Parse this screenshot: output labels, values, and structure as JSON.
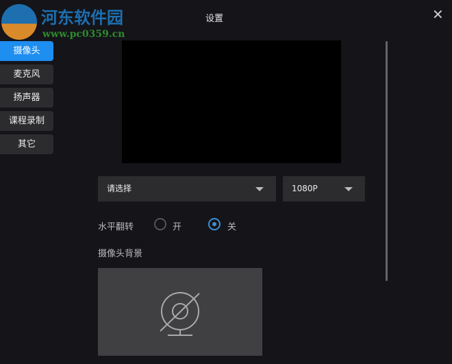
{
  "logo": {
    "text": "河东软件园",
    "url": "www.pc0359.cn"
  },
  "title": "设置",
  "nav": [
    {
      "label": "摄像头",
      "active": true
    },
    {
      "label": "麦克风"
    },
    {
      "label": "扬声器"
    },
    {
      "label": "课程录制"
    },
    {
      "label": "其它"
    }
  ],
  "camera_select": {
    "value": "请选择"
  },
  "resolution_select": {
    "value": "1080P"
  },
  "mirror": {
    "label": "水平翻转",
    "on": "开",
    "off": "关",
    "selected": "关"
  },
  "background": {
    "label": "摄像头背景"
  },
  "colors": {
    "accent": "#1e8ef0"
  }
}
